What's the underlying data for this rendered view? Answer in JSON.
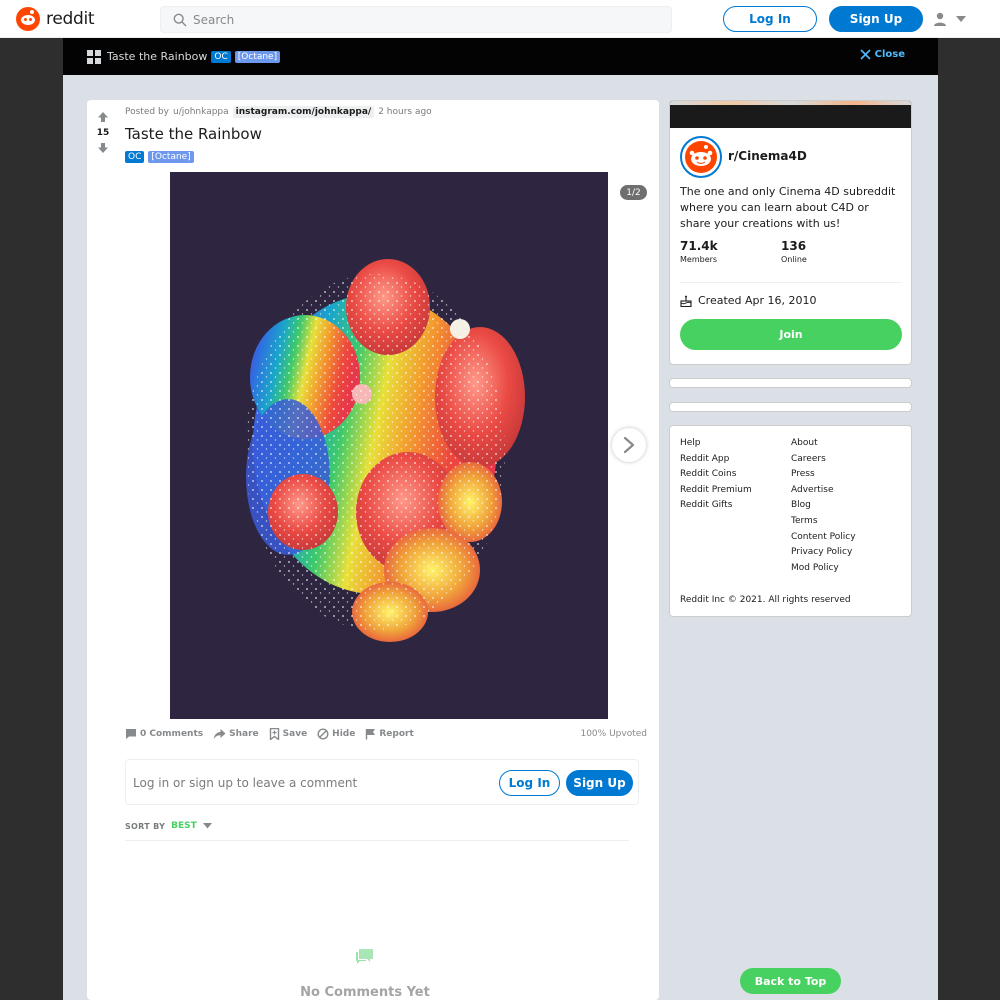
{
  "header": {
    "logo_text": "reddit",
    "search_placeholder": "Search",
    "login_label": "Log In",
    "signup_label": "Sign Up",
    "icons": [
      "reddit-logo-icon",
      "search-icon",
      "user-icon",
      "caret-down-icon"
    ]
  },
  "overlay_bar": {
    "title": "Taste the Rainbow",
    "flair_oc": "OC",
    "flair_octane": "[Octane]",
    "close_label": "Close"
  },
  "post": {
    "vote_count": "15",
    "posted_by_prefix": "Posted by",
    "author": "u/johnkappa",
    "link": "instagram.com/johnkappa/",
    "time_ago": "2 hours ago",
    "title": "Taste the Rainbow",
    "flair_oc": "OC",
    "flair_octane": "[Octane]",
    "gallery_counter": "1/2",
    "actions": {
      "comments": "0 Comments",
      "share": "Share",
      "save": "Save",
      "hide": "Hide",
      "report": "Report"
    },
    "upvoted": "100% Upvoted"
  },
  "comment_box": {
    "prompt": "Log in or sign up to leave a comment",
    "login_label": "Log In",
    "signup_label": "Sign Up"
  },
  "sort": {
    "label": "SORT BY",
    "value": "BEST"
  },
  "empty_state": {
    "text": "No Comments Yet"
  },
  "sidebar": {
    "community_name": "r/Cinema4D",
    "description": "The one and only Cinema 4D subreddit where you can learn about C4D or share your creations with us!",
    "members_value": "71.4k",
    "members_label": "Members",
    "online_value": "136",
    "online_label": "Online",
    "created": "Created Apr 16, 2010",
    "join_label": "Join"
  },
  "footer": {
    "col1": [
      "Help",
      "Reddit App",
      "Reddit Coins",
      "Reddit Premium",
      "Reddit Gifts"
    ],
    "col2": [
      "About",
      "Careers",
      "Press",
      "Advertise",
      "Blog",
      "Terms",
      "Content Policy",
      "Privacy Policy",
      "Mod Policy"
    ],
    "copyright": "Reddit Inc © 2021. All rights reserved"
  },
  "back_to_top": "Back to Top",
  "colors": {
    "brand_orange": "#ff4500",
    "primary_blue": "#0079d3",
    "join_green": "#46d160",
    "image_bg": "#2e2640"
  }
}
